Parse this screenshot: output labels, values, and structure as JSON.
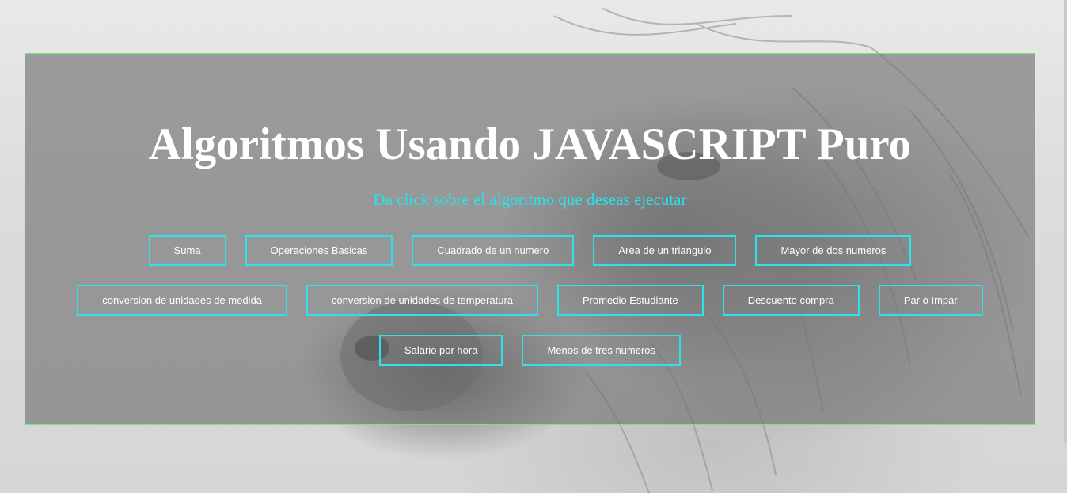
{
  "hero": {
    "title": "Algoritmos Usando JAVASCRIPT Puro",
    "subtitle": "Da click sobre el algoritmo que deseas ejecutar"
  },
  "buttons": {
    "row1": [
      "Suma",
      "Operaciones Basicas",
      "Cuadrado de un numero",
      "Area de un triangulo",
      "Mayor de dos numeros"
    ],
    "row2": [
      "conversion de unidades de medida",
      "conversion de unidades de temperatura",
      "Promedio Estudiante",
      "Descuento compra",
      "Par o Impar"
    ],
    "row3": [
      "Salario por hora",
      "Menos de tres numeros"
    ]
  },
  "colors": {
    "accent": "#2de2ea",
    "panel_border": "#6cf06c",
    "title": "#ffffff"
  }
}
